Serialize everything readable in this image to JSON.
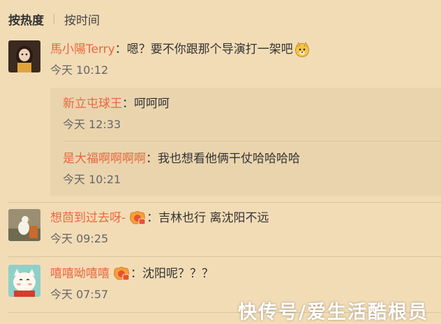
{
  "sort": {
    "hot_label": "按热度",
    "time_label": "按时间"
  },
  "comments": [
    {
      "user": "馬小陽Terry",
      "text": "嗯？要不你跟那个导演打一架吧",
      "time": "今天 10:12"
    },
    {
      "user": "想茴到过去呀-",
      "text": "吉林也行 离沈阳不远",
      "time": "今天 09:25"
    },
    {
      "user": "嘻嘻呦嘻嘻",
      "text": "沈阳呢？？？",
      "time": "今天 07:57"
    }
  ],
  "replies": [
    {
      "user": "新立屯球王",
      "text": "呵呵呵",
      "time": "今天 12:33"
    },
    {
      "user": "是大福啊啊啊啊",
      "text": "我也想看他俩干仗哈哈哈哈",
      "time": "今天 10:21"
    }
  ],
  "colon": "：",
  "watermark": "快传号/爱生活酷根员"
}
